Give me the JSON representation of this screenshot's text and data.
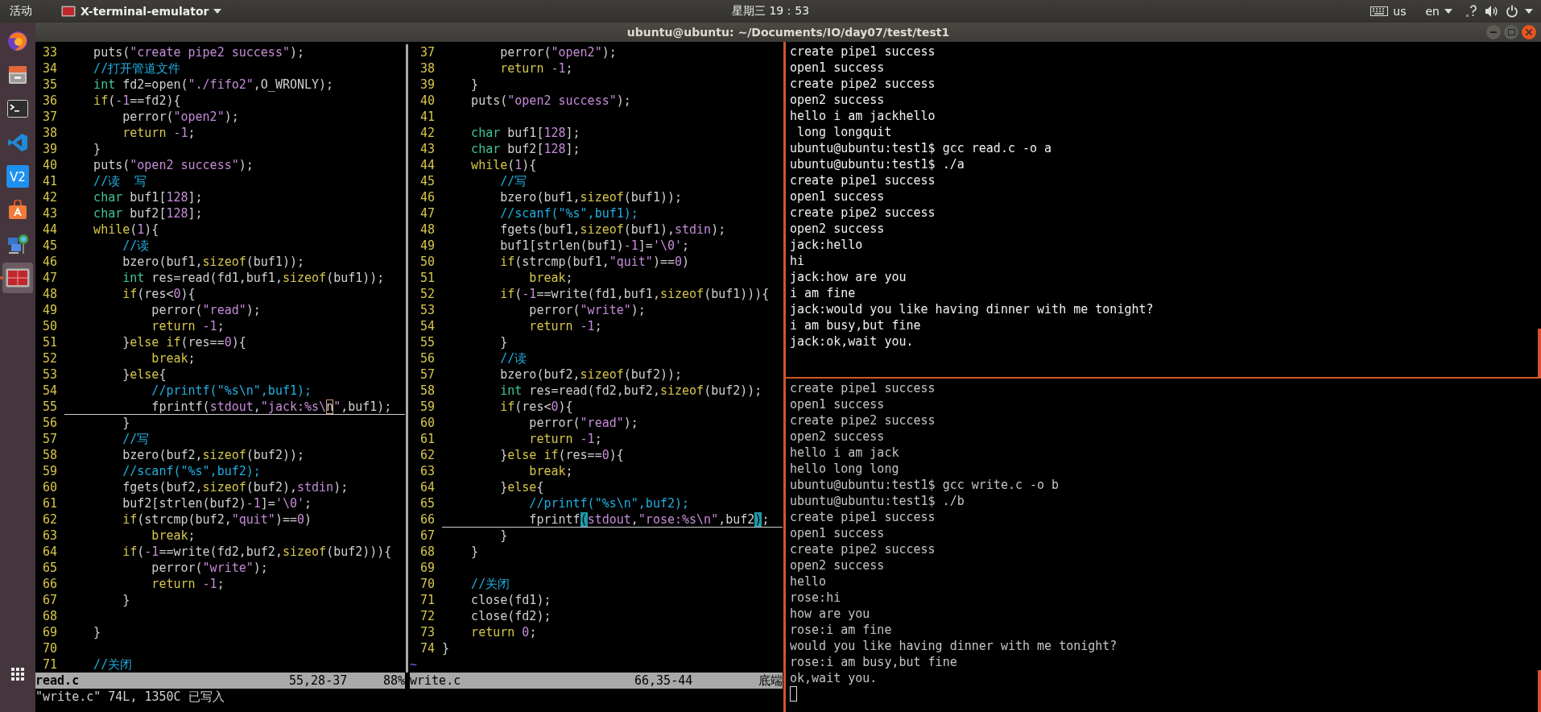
{
  "top_bar": {
    "activities": "活动",
    "app_menu": "X-terminal-emulator",
    "clock": "星期三 19：53",
    "keyboard": "us",
    "language": "en"
  },
  "dock": [
    {
      "kind": "browser",
      "selected": false
    },
    {
      "kind": "cabinet",
      "selected": false
    },
    {
      "kind": "terminal",
      "selected": false
    },
    {
      "kind": "editor",
      "selected": false
    },
    {
      "kind": "badge",
      "label": "V2",
      "selected": false
    },
    {
      "kind": "store",
      "selected": false
    },
    {
      "kind": "network",
      "selected": false
    },
    {
      "kind": "terminator",
      "selected": true
    }
  ],
  "window": {
    "title": "ubuntu@ubuntu: ~/Documents/IO/day07/test/test1"
  },
  "vim": {
    "panes": [
      {
        "file": "read.c",
        "active": true,
        "position": "55,28-37",
        "scroll": "88%",
        "lines": [
          {
            "number": "33",
            "current": false,
            "tokens": [
              {
                "text": "    puts(",
                "kind": "plain"
              },
              {
                "text": "\"create pipe2 success\"",
                "kind": "str"
              },
              {
                "text": ");",
                "kind": "plain"
              }
            ]
          },
          {
            "number": "34",
            "current": false,
            "tokens": [
              {
                "text": "    //打开管道文件",
                "kind": "comment"
              }
            ]
          },
          {
            "number": "35",
            "current": false,
            "tokens": [
              {
                "text": "    int",
                "kind": "type"
              },
              {
                "text": " fd2=open(",
                "kind": "plain"
              },
              {
                "text": "\"./fifo2\"",
                "kind": "str"
              },
              {
                "text": ",O_WRONLY);",
                "kind": "plain"
              }
            ]
          },
          {
            "number": "36",
            "current": false,
            "tokens": [
              {
                "text": "    if",
                "kind": "stmt"
              },
              {
                "text": "(",
                "kind": "plain"
              },
              {
                "text": "-1",
                "kind": "num"
              },
              {
                "text": "==fd2){",
                "kind": "plain"
              }
            ]
          },
          {
            "number": "37",
            "current": false,
            "tokens": [
              {
                "text": "        perror(",
                "kind": "plain"
              },
              {
                "text": "\"open2\"",
                "kind": "str"
              },
              {
                "text": ");",
                "kind": "plain"
              }
            ]
          },
          {
            "number": "38",
            "current": false,
            "tokens": [
              {
                "text": "        return",
                "kind": "stmt"
              },
              {
                "text": " -1",
                "kind": "num"
              },
              {
                "text": ";",
                "kind": "plain"
              }
            ]
          },
          {
            "number": "39",
            "current": false,
            "tokens": [
              {
                "text": "    }",
                "kind": "plain"
              }
            ]
          },
          {
            "number": "40",
            "current": false,
            "tokens": [
              {
                "text": "    puts(",
                "kind": "plain"
              },
              {
                "text": "\"open2 success\"",
                "kind": "str"
              },
              {
                "text": ");",
                "kind": "plain"
              }
            ]
          },
          {
            "number": "41",
            "current": false,
            "tokens": [
              {
                "text": "    //读  写",
                "kind": "comment"
              }
            ]
          },
          {
            "number": "42",
            "current": false,
            "tokens": [
              {
                "text": "    char",
                "kind": "type"
              },
              {
                "text": " buf1[",
                "kind": "plain"
              },
              {
                "text": "128",
                "kind": "num"
              },
              {
                "text": "];",
                "kind": "plain"
              }
            ]
          },
          {
            "number": "43",
            "current": false,
            "tokens": [
              {
                "text": "    char",
                "kind": "type"
              },
              {
                "text": " buf2[",
                "kind": "plain"
              },
              {
                "text": "128",
                "kind": "num"
              },
              {
                "text": "];",
                "kind": "plain"
              }
            ]
          },
          {
            "number": "44",
            "current": false,
            "tokens": [
              {
                "text": "    while",
                "kind": "stmt"
              },
              {
                "text": "(",
                "kind": "plain"
              },
              {
                "text": "1",
                "kind": "num"
              },
              {
                "text": "){",
                "kind": "plain"
              }
            ]
          },
          {
            "number": "45",
            "current": false,
            "tokens": [
              {
                "text": "        //读",
                "kind": "comment"
              }
            ]
          },
          {
            "number": "46",
            "current": false,
            "tokens": [
              {
                "text": "        bzero(buf1,",
                "kind": "plain"
              },
              {
                "text": "sizeof",
                "kind": "stmt"
              },
              {
                "text": "(buf1));",
                "kind": "plain"
              }
            ]
          },
          {
            "number": "47",
            "current": false,
            "tokens": [
              {
                "text": "        int",
                "kind": "type"
              },
              {
                "text": " res=read(fd1,buf1,",
                "kind": "plain"
              },
              {
                "text": "sizeof",
                "kind": "stmt"
              },
              {
                "text": "(buf1));",
                "kind": "plain"
              }
            ]
          },
          {
            "number": "48",
            "current": false,
            "tokens": [
              {
                "text": "        if",
                "kind": "stmt"
              },
              {
                "text": "(res<",
                "kind": "plain"
              },
              {
                "text": "0",
                "kind": "num"
              },
              {
                "text": "){",
                "kind": "plain"
              }
            ]
          },
          {
            "number": "49",
            "current": false,
            "tokens": [
              {
                "text": "            perror(",
                "kind": "plain"
              },
              {
                "text": "\"read\"",
                "kind": "str"
              },
              {
                "text": ");",
                "kind": "plain"
              }
            ]
          },
          {
            "number": "50",
            "current": false,
            "tokens": [
              {
                "text": "            return",
                "kind": "stmt"
              },
              {
                "text": " -1",
                "kind": "num"
              },
              {
                "text": ";",
                "kind": "plain"
              }
            ]
          },
          {
            "number": "51",
            "current": false,
            "tokens": [
              {
                "text": "        }",
                "kind": "plain"
              },
              {
                "text": "else",
                "kind": "stmt"
              },
              {
                "text": " if",
                "kind": "stmt"
              },
              {
                "text": "(res==",
                "kind": "plain"
              },
              {
                "text": "0",
                "kind": "num"
              },
              {
                "text": "){",
                "kind": "plain"
              }
            ]
          },
          {
            "number": "52",
            "current": false,
            "tokens": [
              {
                "text": "            break",
                "kind": "stmt"
              },
              {
                "text": ";",
                "kind": "plain"
              }
            ]
          },
          {
            "number": "53",
            "current": false,
            "tokens": [
              {
                "text": "        }",
                "kind": "plain"
              },
              {
                "text": "else",
                "kind": "stmt"
              },
              {
                "text": "{",
                "kind": "plain"
              }
            ]
          },
          {
            "number": "54",
            "current": false,
            "tokens": [
              {
                "text": "            //printf(\"%s\\n\",buf1);",
                "kind": "comment"
              }
            ]
          },
          {
            "number": "55",
            "current": true,
            "tokens": [
              {
                "text": "            fprintf(",
                "kind": "plain"
              },
              {
                "text": "stdout",
                "kind": "const"
              },
              {
                "text": ",",
                "kind": "plain"
              },
              {
                "text": "\"jack:%s\\",
                "kind": "str"
              },
              {
                "text": "n",
                "kind": "cursor"
              },
              {
                "text": "\"",
                "kind": "str"
              },
              {
                "text": ",buf1);",
                "kind": "plain"
              }
            ]
          },
          {
            "number": "56",
            "current": false,
            "tokens": [
              {
                "text": "        }",
                "kind": "plain"
              }
            ]
          },
          {
            "number": "57",
            "current": false,
            "tokens": [
              {
                "text": "        //写",
                "kind": "comment"
              }
            ]
          },
          {
            "number": "58",
            "current": false,
            "tokens": [
              {
                "text": "        bzero(buf2,",
                "kind": "plain"
              },
              {
                "text": "sizeof",
                "kind": "stmt"
              },
              {
                "text": "(buf2));",
                "kind": "plain"
              }
            ]
          },
          {
            "number": "59",
            "current": false,
            "tokens": [
              {
                "text": "        //scanf(\"%s\",buf2);",
                "kind": "comment"
              }
            ]
          },
          {
            "number": "60",
            "current": false,
            "tokens": [
              {
                "text": "        fgets(buf2,",
                "kind": "plain"
              },
              {
                "text": "sizeof",
                "kind": "stmt"
              },
              {
                "text": "(buf2),",
                "kind": "plain"
              },
              {
                "text": "stdin",
                "kind": "const"
              },
              {
                "text": ");",
                "kind": "plain"
              }
            ]
          },
          {
            "number": "61",
            "current": false,
            "tokens": [
              {
                "text": "        buf2[strlen(buf2)",
                "kind": "plain"
              },
              {
                "text": "-1",
                "kind": "num"
              },
              {
                "text": "]=",
                "kind": "plain"
              },
              {
                "text": "'\\0'",
                "kind": "str"
              },
              {
                "text": ";",
                "kind": "plain"
              }
            ]
          },
          {
            "number": "62",
            "current": false,
            "tokens": [
              {
                "text": "        if",
                "kind": "stmt"
              },
              {
                "text": "(strcmp(buf2,",
                "kind": "plain"
              },
              {
                "text": "\"quit\"",
                "kind": "str"
              },
              {
                "text": ")==",
                "kind": "plain"
              },
              {
                "text": "0",
                "kind": "num"
              },
              {
                "text": ")",
                "kind": "plain"
              }
            ]
          },
          {
            "number": "63",
            "current": false,
            "tokens": [
              {
                "text": "            break",
                "kind": "stmt"
              },
              {
                "text": ";",
                "kind": "plain"
              }
            ]
          },
          {
            "number": "64",
            "current": false,
            "tokens": [
              {
                "text": "        if",
                "kind": "stmt"
              },
              {
                "text": "(",
                "kind": "plain"
              },
              {
                "text": "-1",
                "kind": "num"
              },
              {
                "text": "==write(fd2,buf2,",
                "kind": "plain"
              },
              {
                "text": "sizeof",
                "kind": "stmt"
              },
              {
                "text": "(buf2))){",
                "kind": "plain"
              }
            ]
          },
          {
            "number": "65",
            "current": false,
            "tokens": [
              {
                "text": "            perror(",
                "kind": "plain"
              },
              {
                "text": "\"write\"",
                "kind": "str"
              },
              {
                "text": ");",
                "kind": "plain"
              }
            ]
          },
          {
            "number": "66",
            "current": false,
            "tokens": [
              {
                "text": "            return",
                "kind": "stmt"
              },
              {
                "text": " -1",
                "kind": "num"
              },
              {
                "text": ";",
                "kind": "plain"
              }
            ]
          },
          {
            "number": "67",
            "current": false,
            "tokens": [
              {
                "text": "        }",
                "kind": "plain"
              }
            ]
          },
          {
            "number": "68",
            "current": false
          },
          {
            "number": "69",
            "current": false,
            "tokens": [
              {
                "text": "    }",
                "kind": "plain"
              }
            ]
          },
          {
            "number": "70",
            "current": false
          },
          {
            "number": "71",
            "current": false,
            "tokens": [
              {
                "text": "    //关闭",
                "kind": "comment"
              }
            ]
          }
        ]
      },
      {
        "file": "write.c",
        "active": false,
        "position": "66,35-44",
        "scroll": "底端",
        "filler": [
          "~"
        ],
        "lines": [
          {
            "number": "37",
            "current": false,
            "tokens": [
              {
                "text": "        perror(",
                "kind": "plain"
              },
              {
                "text": "\"open2\"",
                "kind": "str"
              },
              {
                "text": ");",
                "kind": "plain"
              }
            ]
          },
          {
            "number": "38",
            "current": false,
            "tokens": [
              {
                "text": "        return",
                "kind": "stmt"
              },
              {
                "text": " -1",
                "kind": "num"
              },
              {
                "text": ";",
                "kind": "plain"
              }
            ]
          },
          {
            "number": "39",
            "current": false,
            "tokens": [
              {
                "text": "    }",
                "kind": "plain"
              }
            ]
          },
          {
            "number": "40",
            "current": false,
            "tokens": [
              {
                "text": "    puts(",
                "kind": "plain"
              },
              {
                "text": "\"open2 success\"",
                "kind": "str"
              },
              {
                "text": ");",
                "kind": "plain"
              }
            ]
          },
          {
            "number": "41",
            "current": false
          },
          {
            "number": "42",
            "current": false,
            "tokens": [
              {
                "text": "    char",
                "kind": "type"
              },
              {
                "text": " buf1[",
                "kind": "plain"
              },
              {
                "text": "128",
                "kind": "num"
              },
              {
                "text": "];",
                "kind": "plain"
              }
            ]
          },
          {
            "number": "43",
            "current": false,
            "tokens": [
              {
                "text": "    char",
                "kind": "type"
              },
              {
                "text": " buf2[",
                "kind": "plain"
              },
              {
                "text": "128",
                "kind": "num"
              },
              {
                "text": "];",
                "kind": "plain"
              }
            ]
          },
          {
            "number": "44",
            "current": false,
            "tokens": [
              {
                "text": "    while",
                "kind": "stmt"
              },
              {
                "text": "(",
                "kind": "plain"
              },
              {
                "text": "1",
                "kind": "num"
              },
              {
                "text": "){",
                "kind": "plain"
              }
            ]
          },
          {
            "number": "45",
            "current": false,
            "tokens": [
              {
                "text": "        //写",
                "kind": "comment"
              }
            ]
          },
          {
            "number": "46",
            "current": false,
            "tokens": [
              {
                "text": "        bzero(buf1,",
                "kind": "plain"
              },
              {
                "text": "sizeof",
                "kind": "stmt"
              },
              {
                "text": "(buf1));",
                "kind": "plain"
              }
            ]
          },
          {
            "number": "47",
            "current": false,
            "tokens": [
              {
                "text": "        //scanf(\"%s\",buf1);",
                "kind": "comment"
              }
            ]
          },
          {
            "number": "48",
            "current": false,
            "tokens": [
              {
                "text": "        fgets(buf1,",
                "kind": "plain"
              },
              {
                "text": "sizeof",
                "kind": "stmt"
              },
              {
                "text": "(buf1),",
                "kind": "plain"
              },
              {
                "text": "stdin",
                "kind": "const"
              },
              {
                "text": ");",
                "kind": "plain"
              }
            ]
          },
          {
            "number": "49",
            "current": false,
            "tokens": [
              {
                "text": "        buf1[strlen(buf1)",
                "kind": "plain"
              },
              {
                "text": "-1",
                "kind": "num"
              },
              {
                "text": "]=",
                "kind": "plain"
              },
              {
                "text": "'\\0'",
                "kind": "str"
              },
              {
                "text": ";",
                "kind": "plain"
              }
            ]
          },
          {
            "number": "50",
            "current": false,
            "tokens": [
              {
                "text": "        if",
                "kind": "stmt"
              },
              {
                "text": "(strcmp(buf1,",
                "kind": "plain"
              },
              {
                "text": "\"quit\"",
                "kind": "str"
              },
              {
                "text": ")==",
                "kind": "plain"
              },
              {
                "text": "0",
                "kind": "num"
              },
              {
                "text": ")",
                "kind": "plain"
              }
            ]
          },
          {
            "number": "51",
            "current": false,
            "tokens": [
              {
                "text": "            break",
                "kind": "stmt"
              },
              {
                "text": ";",
                "kind": "plain"
              }
            ]
          },
          {
            "number": "52",
            "current": false,
            "tokens": [
              {
                "text": "        if",
                "kind": "stmt"
              },
              {
                "text": "(",
                "kind": "plain"
              },
              {
                "text": "-1",
                "kind": "num"
              },
              {
                "text": "==write(fd1,buf1,",
                "kind": "plain"
              },
              {
                "text": "sizeof",
                "kind": "stmt"
              },
              {
                "text": "(buf1))){",
                "kind": "plain"
              }
            ]
          },
          {
            "number": "53",
            "current": false,
            "tokens": [
              {
                "text": "            perror(",
                "kind": "plain"
              },
              {
                "text": "\"write\"",
                "kind": "str"
              },
              {
                "text": ");",
                "kind": "plain"
              }
            ]
          },
          {
            "number": "54",
            "current": false,
            "tokens": [
              {
                "text": "            return",
                "kind": "stmt"
              },
              {
                "text": " -1",
                "kind": "num"
              },
              {
                "text": ";",
                "kind": "plain"
              }
            ]
          },
          {
            "number": "55",
            "current": false,
            "tokens": [
              {
                "text": "        }",
                "kind": "plain"
              }
            ]
          },
          {
            "number": "56",
            "current": false,
            "tokens": [
              {
                "text": "        //读",
                "kind": "comment"
              }
            ]
          },
          {
            "number": "57",
            "current": false,
            "tokens": [
              {
                "text": "        bzero(buf2,",
                "kind": "plain"
              },
              {
                "text": "sizeof",
                "kind": "stmt"
              },
              {
                "text": "(buf2));",
                "kind": "plain"
              }
            ]
          },
          {
            "number": "58",
            "current": false,
            "tokens": [
              {
                "text": "        int",
                "kind": "type"
              },
              {
                "text": " res=read(fd2,buf2,",
                "kind": "plain"
              },
              {
                "text": "sizeof",
                "kind": "stmt"
              },
              {
                "text": "(buf2));",
                "kind": "plain"
              }
            ]
          },
          {
            "number": "59",
            "current": false,
            "tokens": [
              {
                "text": "        if",
                "kind": "stmt"
              },
              {
                "text": "(res<",
                "kind": "plain"
              },
              {
                "text": "0",
                "kind": "num"
              },
              {
                "text": "){",
                "kind": "plain"
              }
            ]
          },
          {
            "number": "60",
            "current": false,
            "tokens": [
              {
                "text": "            perror(",
                "kind": "plain"
              },
              {
                "text": "\"read\"",
                "kind": "str"
              },
              {
                "text": ");",
                "kind": "plain"
              }
            ]
          },
          {
            "number": "61",
            "current": false,
            "tokens": [
              {
                "text": "            return",
                "kind": "stmt"
              },
              {
                "text": " -1",
                "kind": "num"
              },
              {
                "text": ";",
                "kind": "plain"
              }
            ]
          },
          {
            "number": "62",
            "current": false,
            "tokens": [
              {
                "text": "        }",
                "kind": "plain"
              },
              {
                "text": "else",
                "kind": "stmt"
              },
              {
                "text": " if",
                "kind": "stmt"
              },
              {
                "text": "(res==",
                "kind": "plain"
              },
              {
                "text": "0",
                "kind": "num"
              },
              {
                "text": "){",
                "kind": "plain"
              }
            ]
          },
          {
            "number": "63",
            "current": false,
            "tokens": [
              {
                "text": "            break",
                "kind": "stmt"
              },
              {
                "text": ";",
                "kind": "plain"
              }
            ]
          },
          {
            "number": "64",
            "current": false,
            "tokens": [
              {
                "text": "        }",
                "kind": "plain"
              },
              {
                "text": "else",
                "kind": "stmt"
              },
              {
                "text": "{",
                "kind": "plain"
              }
            ]
          },
          {
            "number": "65",
            "current": false,
            "tokens": [
              {
                "text": "            //printf(\"%s\\n\",buf2);",
                "kind": "comment"
              }
            ]
          },
          {
            "number": "66",
            "current": true,
            "tokens": [
              {
                "text": "            fprintf",
                "kind": "plain"
              },
              {
                "text": "(",
                "kind": "match"
              },
              {
                "text": "stdout",
                "kind": "const"
              },
              {
                "text": ",",
                "kind": "plain"
              },
              {
                "text": "\"rose:%s\\n\"",
                "kind": "str"
              },
              {
                "text": ",buf2",
                "kind": "plain"
              },
              {
                "text": ")",
                "kind": "match"
              },
              {
                "text": ";",
                "kind": "plain"
              }
            ]
          },
          {
            "number": "67",
            "current": false,
            "tokens": [
              {
                "text": "        }",
                "kind": "plain"
              }
            ]
          },
          {
            "number": "68",
            "current": false,
            "tokens": [
              {
                "text": "    }",
                "kind": "plain"
              }
            ]
          },
          {
            "number": "69",
            "current": false
          },
          {
            "number": "70",
            "current": false,
            "tokens": [
              {
                "text": "    //关闭",
                "kind": "comment"
              }
            ]
          },
          {
            "number": "71",
            "current": false,
            "tokens": [
              {
                "text": "    close(fd1);",
                "kind": "plain"
              }
            ]
          },
          {
            "number": "72",
            "current": false,
            "tokens": [
              {
                "text": "    close(fd2);",
                "kind": "plain"
              }
            ]
          },
          {
            "number": "73",
            "current": false,
            "tokens": [
              {
                "text": "    return",
                "kind": "stmt"
              },
              {
                "text": " 0",
                "kind": "num"
              },
              {
                "text": ";",
                "kind": "plain"
              }
            ]
          },
          {
            "number": "74",
            "current": false,
            "tokens": [
              {
                "text": "}",
                "kind": "plain"
              }
            ]
          }
        ]
      }
    ],
    "command_line": "\"write.c\" 74L, 1350C 已写入"
  },
  "terminals": [
    {
      "focused": true,
      "cursor": false,
      "lines": [
        "create pipe1 success",
        "open1 success",
        "create pipe2 success",
        "open2 success",
        "hello i am jackhello",
        " long longquit",
        "ubuntu@ubuntu:test1$ gcc read.c -o a",
        "ubuntu@ubuntu:test1$ ./a",
        "create pipe1 success",
        "open1 success",
        "create pipe2 success",
        "open2 success",
        "jack:hello",
        "hi",
        "jack:how are you",
        "i am fine",
        "jack:would you like having dinner with me tonight?",
        "i am busy,but fine",
        "jack:ok,wait you."
      ]
    },
    {
      "focused": false,
      "cursor": true,
      "lines": [
        "create pipe1 success",
        "open1 success",
        "create pipe2 success",
        "open2 success",
        "hello i am jack",
        "hello long long",
        "ubuntu@ubuntu:test1$ gcc write.c -o b",
        "ubuntu@ubuntu:test1$ ./b",
        "create pipe1 success",
        "open1 success",
        "create pipe2 success",
        "open2 success",
        "hello",
        "rose:hi",
        "how are you",
        "rose:i am fine",
        "would you like having dinner with me tonight?",
        "rose:i am busy,but fine",
        "ok,wait you."
      ]
    }
  ]
}
